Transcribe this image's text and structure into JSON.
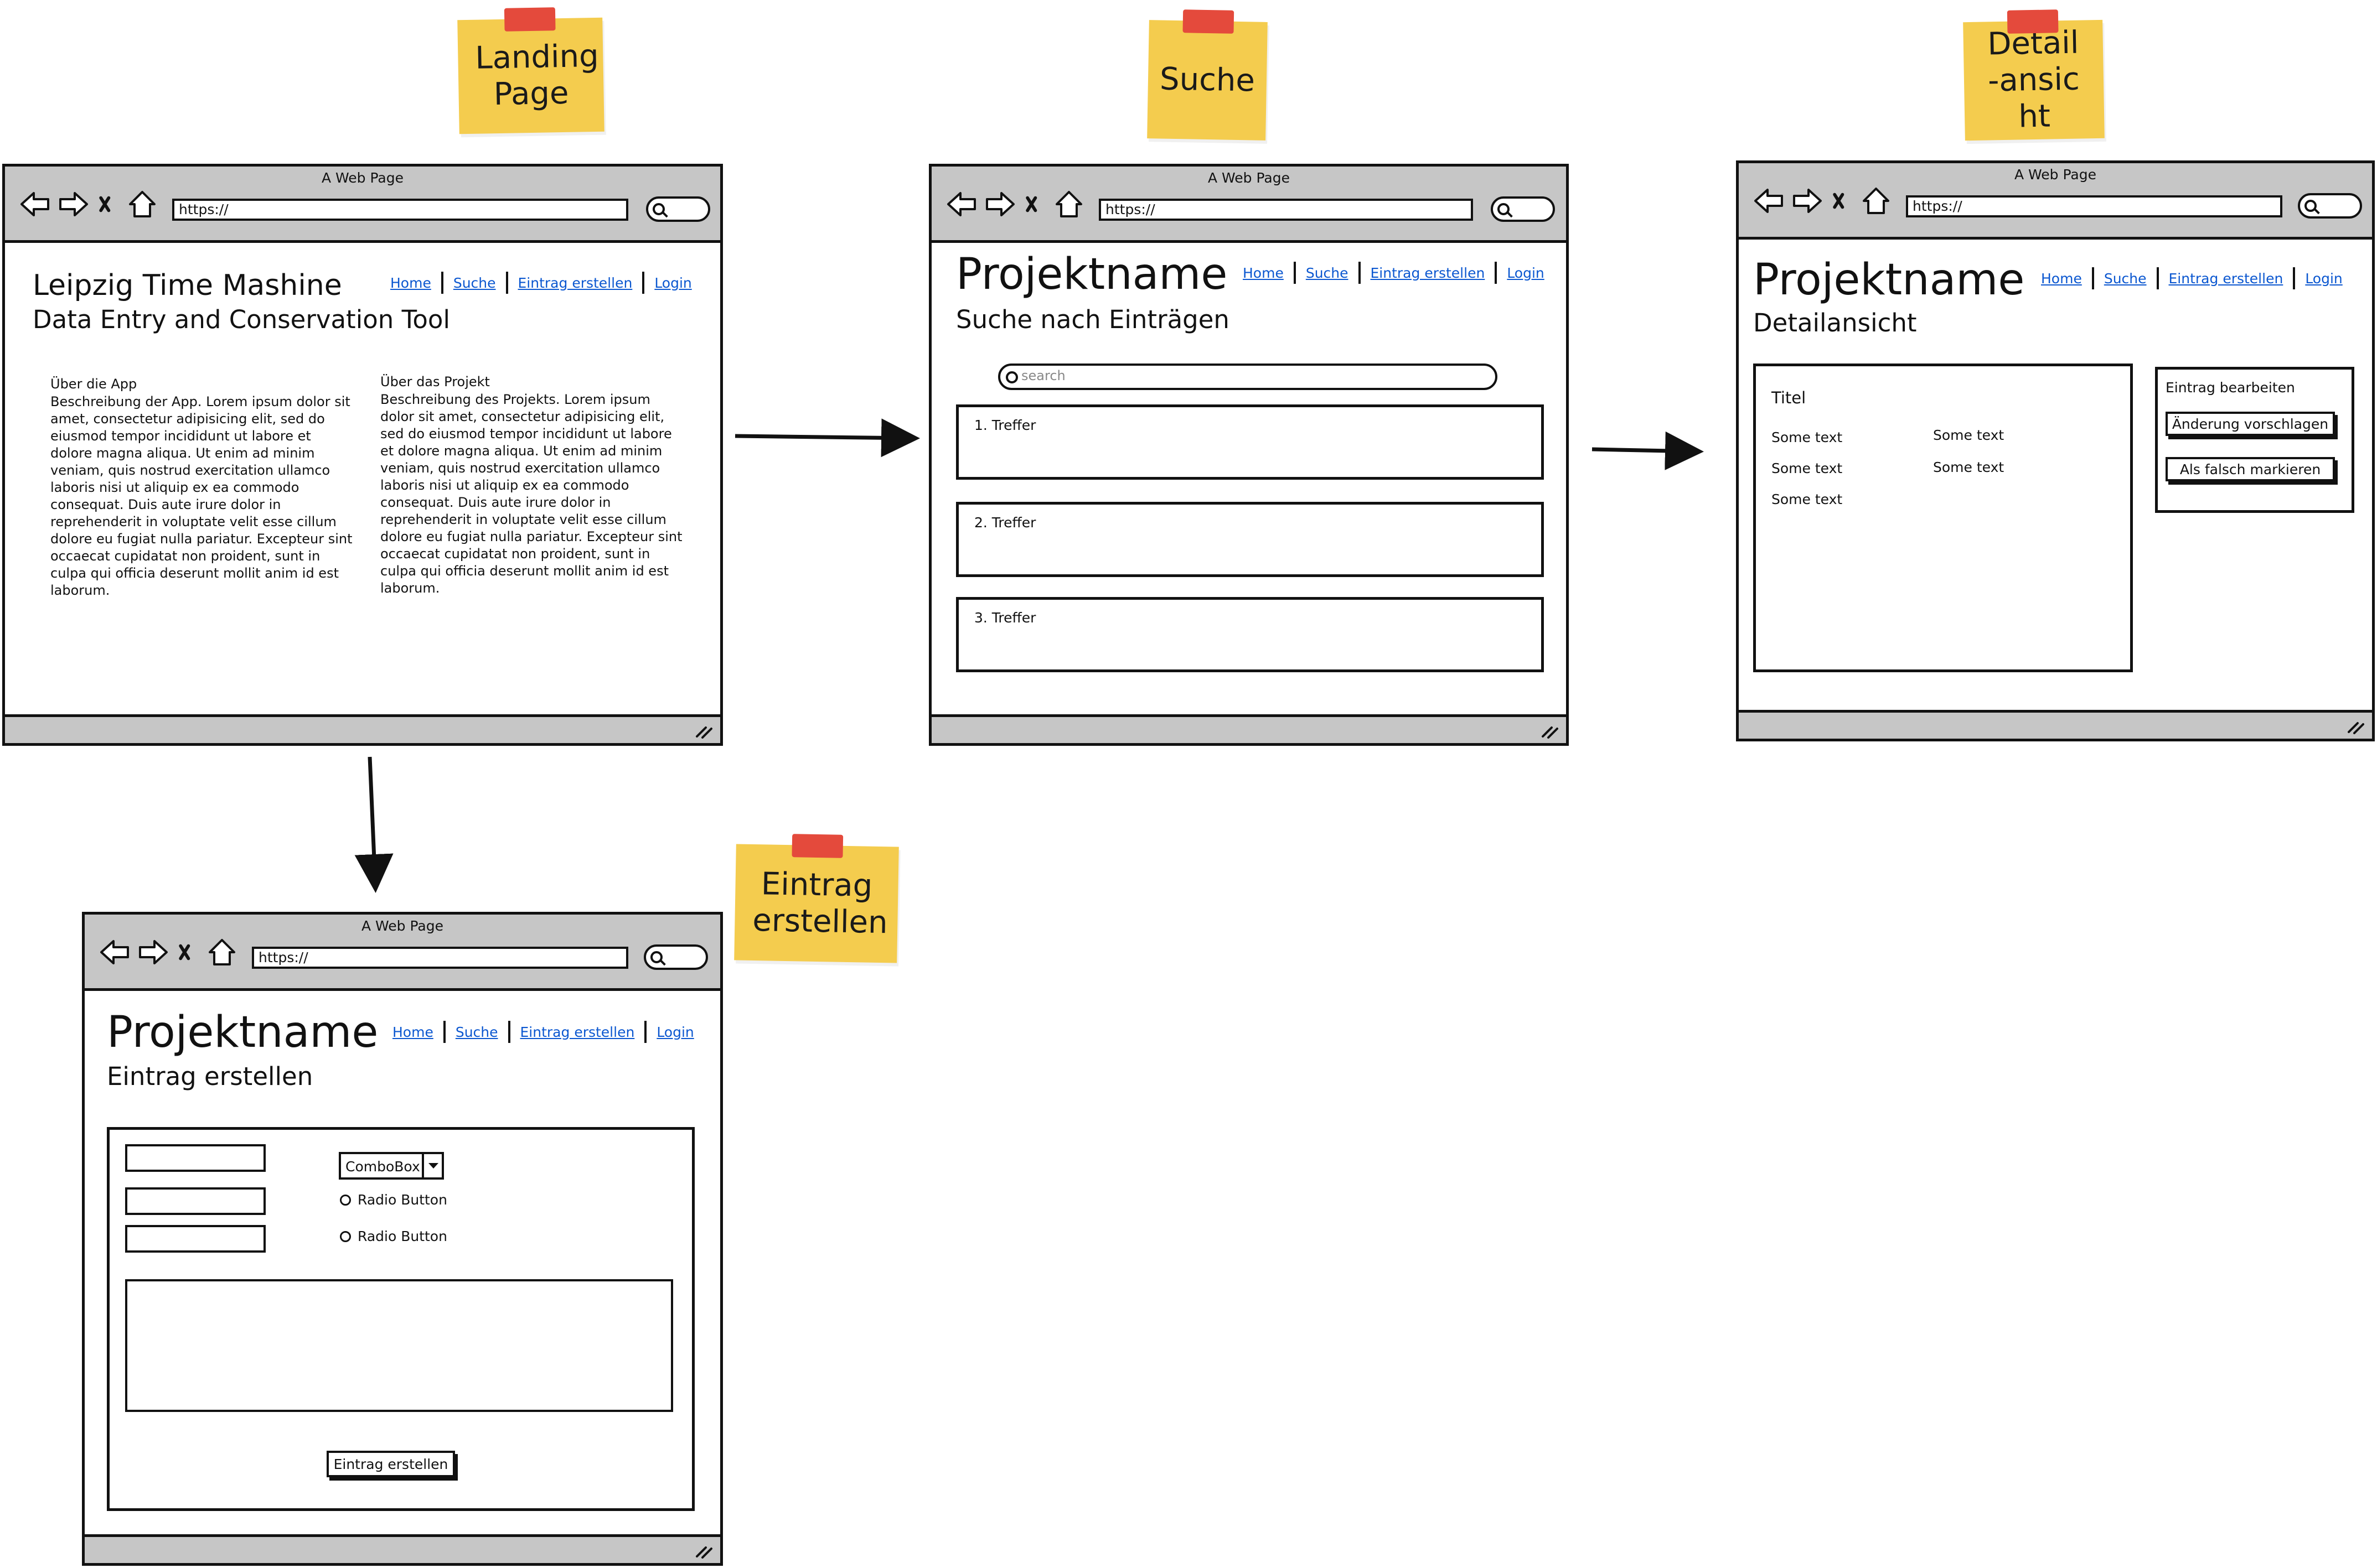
{
  "notes": {
    "landing": "Landing Page",
    "suche": "Suche",
    "detail": "Detail-ansicht",
    "eintrag": "Eintrag erstellen"
  },
  "browser": {
    "window_title": "A Web Page",
    "url": "https://",
    "icons": [
      "back-arrow-icon",
      "forward-arrow-icon",
      "close-icon",
      "home-icon",
      "search-icon",
      "resize-grip-icon"
    ]
  },
  "nav": {
    "home": "Home",
    "suche": "Suche",
    "eintrag": "Eintrag erstellen",
    "login": "Login"
  },
  "landing": {
    "title": "Leipzig Time Mashine",
    "subtitle": "Data Entry and Conservation Tool",
    "app_heading": "Über die App",
    "app_text": "Beschreibung der App. Lorem ipsum dolor sit amet, consectetur adipisicing elit, sed do eiusmod tempor incididunt ut labore et dolore magna aliqua. Ut enim ad minim veniam, quis nostrud exercitation ullamco laboris nisi ut aliquip ex ea commodo consequat. Duis aute irure dolor in reprehenderit in voluptate velit esse cillum dolore eu fugiat nulla pariatur. Excepteur sint occaecat cupidatat non proident, sunt in culpa qui officia deserunt mollit anim id est laborum.",
    "project_heading": "Über das Projekt",
    "project_text": "Beschreibung des Projekts. Lorem ipsum dolor sit amet, consectetur adipisicing elit, sed do eiusmod tempor incididunt ut labore et dolore magna aliqua. Ut enim ad minim veniam, quis nostrud exercitation ullamco laboris nisi ut aliquip ex ea commodo consequat. Duis aute irure dolor in reprehenderit in voluptate velit esse cillum dolore eu fugiat nulla pariatur. Excepteur sint occaecat cupidatat non proident, sunt in culpa qui officia deserunt mollit anim id est laborum."
  },
  "suche": {
    "title": "Projektname",
    "subtitle": "Suche nach Einträgen",
    "search_placeholder": "search",
    "results": [
      "1. Treffer",
      "2. Treffer",
      "3. Treffer"
    ]
  },
  "detail": {
    "title": "Projektname",
    "subtitle": "Detailansicht",
    "card_title": "Titel",
    "col1": [
      "Some text",
      "Some text",
      "Some text"
    ],
    "col2": [
      "Some text",
      "Some text"
    ],
    "panel_title": "Eintrag bearbeiten",
    "suggest_button": "Änderung vorschlagen",
    "flag_button": "Als falsch markieren"
  },
  "eintrag": {
    "title": "Projektname",
    "subtitle": "Eintrag erstellen",
    "combobox": "ComboBox",
    "radio1": "Radio Button",
    "radio2": "Radio Button",
    "submit": "Eintrag erstellen"
  }
}
